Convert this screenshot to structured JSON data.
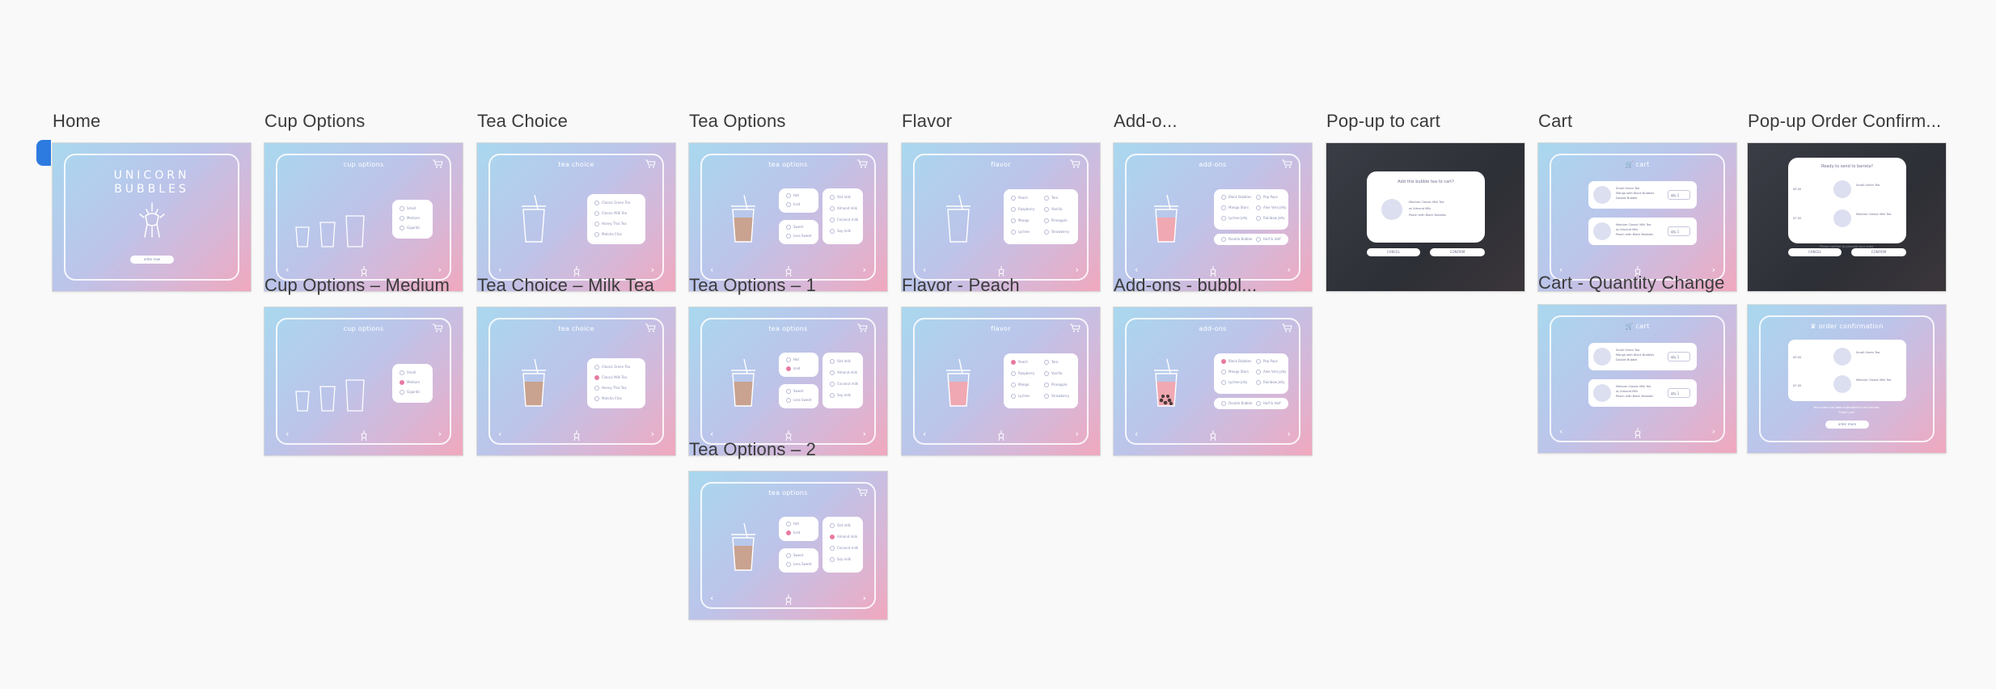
{
  "artboards": [
    {
      "title": "Home"
    },
    {
      "title": "Cup Options"
    },
    {
      "title": "Tea Choice"
    },
    {
      "title": "Tea Options"
    },
    {
      "title": "Flavor"
    },
    {
      "title": "Add-o..."
    },
    {
      "title": "Pop-up to cart"
    },
    {
      "title": "Cart"
    },
    {
      "title": "Pop-up Order Confirm..."
    },
    {
      "title": "Cup Options – Medium"
    },
    {
      "title": "Tea Choice – Milk Tea"
    },
    {
      "title": "Tea Options – 1"
    },
    {
      "title": "Flavor - Peach"
    },
    {
      "title": "Add-ons - bubbl..."
    },
    {
      "title": "Cart - Quantity Change"
    },
    {
      "title": "Tea Options – 2"
    }
  ],
  "screens": {
    "home": {
      "title_line1": "UNICORN",
      "title_line2": "BUBBLES",
      "button": "order now"
    },
    "cup_options": {
      "title": "cup options",
      "options": [
        "Small",
        "Medium",
        "Gigantic"
      ]
    },
    "tea_choice": {
      "title": "tea choice",
      "options": [
        "Classic Green Tea",
        "Classic Milk Tea",
        "Honey Thai Tea",
        "Matcha Chai"
      ]
    },
    "tea_options": {
      "title": "tea options",
      "left_options": [
        "Hot",
        "Iced",
        "Less Ice"
      ],
      "sweet_options": [
        "Sweet",
        "Less Sweet",
        "No Sugar"
      ],
      "milk_options": [
        "Oat milk",
        "Almond milk",
        "Coconut milk",
        "Soy milk"
      ]
    },
    "flavor": {
      "title": "flavor",
      "options": [
        "Peach",
        "Raspberry",
        "Mango",
        "Lychee",
        "Taro",
        "Vanilla",
        "Pineapple",
        "Strawberry"
      ]
    },
    "addons": {
      "title": "add-ons",
      "options": [
        "Black Bubbles",
        "Mango Stars",
        "Lychee Jelly",
        "Pop Pops",
        "Aloe Vera Jelly",
        "Rainbow Jelly"
      ],
      "extra_options": [
        "Double Bubble",
        "Half & Half"
      ]
    },
    "popup_cart": {
      "heading": "Add this bubble tea to cart?",
      "desc1": "Medium Classic Milk Tea",
      "desc2": "w/ Almond Milk",
      "desc3": "Peach with Black Bubbles",
      "cancel": "CANCEL",
      "confirm": "CONFIRM"
    },
    "cart": {
      "title": "cart",
      "row1_l1": "Small Green Tea",
      "row1_l2": "Mango with Black Bubbles",
      "row1_l3": "Double Bubble",
      "row2_l1": "Medium Classic Milk Tea",
      "row2_l2": "w/ Almond Milk",
      "row2_l3": "Peach with Black Bubbles",
      "qty_label": "qty",
      "qty1": "1",
      "qty2": "1"
    },
    "popup_order": {
      "heading": "Ready to send to barista?",
      "price1": "$9.00",
      "price2": "$7.00",
      "item1": "Small Green Tea",
      "item2": "Medium Classic Milk Tea",
      "note": "Please confirm to proceed your order",
      "cancel": "CANCEL",
      "confirm": "CONFIRM"
    },
    "order_confirmation": {
      "title": "order confirmation",
      "thanks": "Your order has been submitted to the barista.",
      "thanks2": "Thank you!",
      "button": "order more",
      "price1": "$9.00",
      "price2": "$7.00"
    }
  },
  "colors": {
    "canvas": "#f9f9f9",
    "accent_tab": "#2d7be0",
    "selected": "#e77aa0",
    "milk_tea": "#c9a290",
    "peach": "#f0a8b2"
  }
}
